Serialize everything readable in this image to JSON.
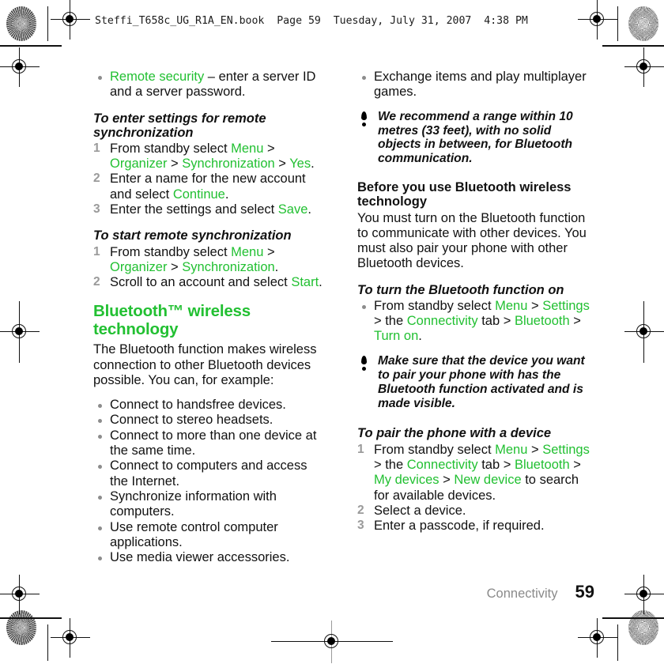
{
  "running_head": "Steffi_T658c_UG_R1A_EN.book  Page 59  Tuesday, July 31, 2007  4:38 PM",
  "colors": {
    "accent_green": "#22c032",
    "body_text": "#111111",
    "step_number": "#9a9a9a",
    "bullet": "#8c8c8c",
    "footer_chapter": "#8a8a8a"
  },
  "left_column": {
    "intro_bullet": {
      "ui_term": "Remote security",
      "rest": " – enter a server ID and a server password."
    },
    "heading_1": "To enter settings for remote synchronization",
    "steps_1": [
      {
        "p1": "From standby select ",
        "ui1": "Menu",
        "p2": " > ",
        "ui2": "Organizer",
        "p3": " > ",
        "ui3": "Synchronization",
        "p4": " > ",
        "ui4": "Yes",
        "p5": "."
      },
      {
        "p1": "Enter a name for the new account and select ",
        "ui1": "Continue",
        "p2": "."
      },
      {
        "p1": "Enter the settings and select ",
        "ui1": "Save",
        "p2": "."
      }
    ],
    "heading_2": "To start remote synchronization",
    "steps_2": [
      {
        "p1": "From standby select ",
        "ui1": "Menu",
        "p2": " > ",
        "ui2": "Organizer",
        "p3": " > ",
        "ui3": "Synchronization",
        "p4": "."
      },
      {
        "p1": "Scroll to an account and select ",
        "ui1": "Start",
        "p2": "."
      }
    ],
    "section_title": "Bluetooth™ wireless technology",
    "section_body": "The Bluetooth function makes wireless connection to other Bluetooth devices possible. You can, for example:",
    "capability_bullets": [
      "Connect to handsfree devices.",
      "Connect to stereo headsets.",
      "Connect to more than one device at the same time.",
      "Connect to computers and access the Internet.",
      "Synchronize information with computers.",
      "Use remote control computer applications.",
      "Use media viewer accessories."
    ]
  },
  "right_column": {
    "capability_bullets": [
      "Exchange items and play multiplayer games."
    ],
    "note_1": "We recommend a range within 10 metres (33 feet), with no solid objects in between, for Bluetooth communication.",
    "heading_1": "Before you use Bluetooth wireless technology",
    "body_1": "You must turn on the Bluetooth function to communicate with other devices. You must also pair your phone with other Bluetooth devices.",
    "heading_2": "To turn the Bluetooth function on",
    "bullet_step": {
      "p1": "From standby select ",
      "ui1": "Menu",
      "p2": " > ",
      "ui2": "Settings",
      "p3": " > the ",
      "ui3": "Connectivity",
      "p4": " tab > ",
      "ui4": "Bluetooth",
      "p5": " > ",
      "ui5": "Turn on",
      "p6": "."
    },
    "note_2": "Make sure that the device you want to pair your phone with has the Bluetooth function activated and is made visible.",
    "heading_3": "To pair the phone with a device",
    "steps": [
      {
        "p1": "From standby select ",
        "ui1": "Menu",
        "p2": " > ",
        "ui2": "Settings",
        "p3": " > the ",
        "ui3": "Connectivity",
        "p4": " tab > ",
        "ui4": "Bluetooth",
        "p5": " > ",
        "ui5": "My devices",
        "p6": " > ",
        "ui6": "New device",
        "p7": " to search for available devices."
      },
      {
        "p1": "Select a device."
      },
      {
        "p1": "Enter a passcode, if required."
      }
    ]
  },
  "footer": {
    "chapter": "Connectivity",
    "page_number": "59"
  }
}
